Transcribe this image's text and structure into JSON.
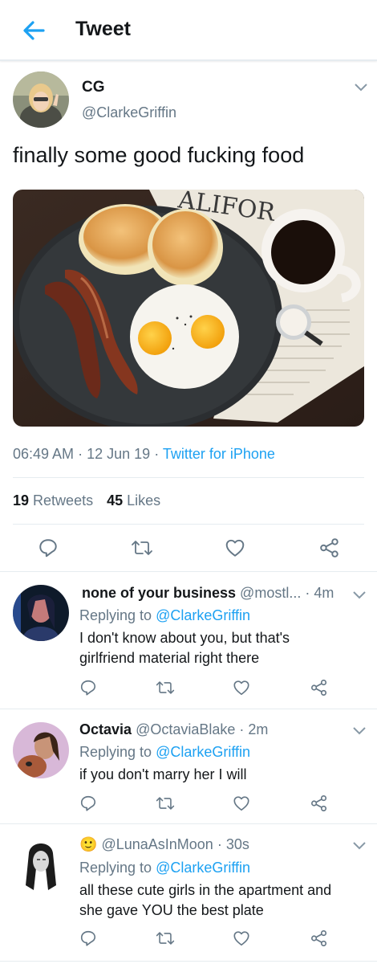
{
  "header": {
    "title": "Tweet"
  },
  "tweet": {
    "display_name": "CG",
    "handle": "@ClarkeGriffin",
    "text": "finally some good fucking food",
    "time": "06:49 AM",
    "date": "12 Jun 19",
    "source": "Twitter for iPhone",
    "retweets_count": "19",
    "retweets_label": "Retweets",
    "likes_count": "45",
    "likes_label": "Likes",
    "image_icon": "breakfast-photo"
  },
  "replies": [
    {
      "display_name": "none of your business",
      "handle": "@mostl...",
      "time": "4m",
      "replying_to_label": "Replying to",
      "replying_to": "@ClarkeGriffin",
      "text_line1": "I don't know about you, but that's",
      "text_line2": "girlfriend material right there"
    },
    {
      "display_name": "Octavia",
      "handle": "@OctaviaBlake",
      "time": "2m",
      "replying_to_label": "Replying to",
      "replying_to": "@ClarkeGriffin",
      "text_line1": "if you don't marry her I will"
    },
    {
      "display_name": "🙂",
      "handle": "@LunaAsInMoon",
      "time": "30s",
      "replying_to_label": "Replying to",
      "replying_to": "@ClarkeGriffin",
      "text_line1": "all these cute girls in the apartment and",
      "text_line2": "she gave YOU the best plate"
    }
  ],
  "separator": "·",
  "colors": {
    "accent": "#1da1f2",
    "muted": "#657786",
    "divider": "#e6ecf0"
  }
}
